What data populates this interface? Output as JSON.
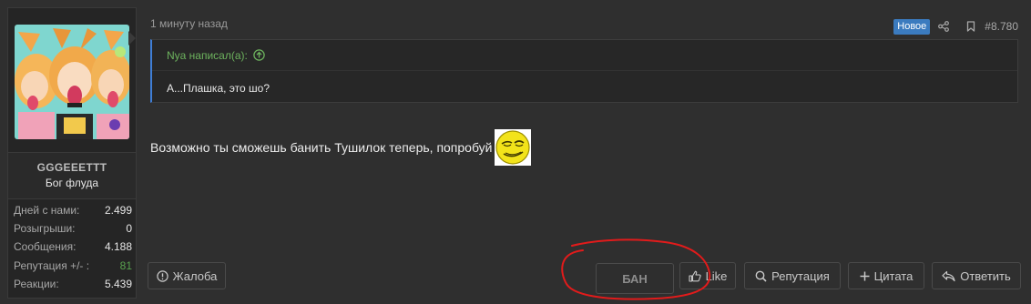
{
  "user": {
    "username": "GGGEEETTT",
    "title": "Бог флуда",
    "stats": [
      {
        "label": "Дней с нами:",
        "value": "2.499",
        "positive": false
      },
      {
        "label": "Розыгрыши:",
        "value": "0",
        "positive": false
      },
      {
        "label": "Сообщения:",
        "value": "4.188",
        "positive": false
      },
      {
        "label": "Репутация +/- :",
        "value": "81",
        "positive": true
      },
      {
        "label": "Реакции:",
        "value": "5.439",
        "positive": false
      }
    ]
  },
  "post": {
    "time": "1 минуту назад",
    "badge": "Новое",
    "number": "#8.780",
    "share_icon": "share-icon",
    "bookmark_icon": "bookmark-icon"
  },
  "quote": {
    "title": "Nya написал(а):",
    "body": "А...Плашка, это шо?"
  },
  "message": {
    "text": "Возможно ты сможешь банить Тушилок теперь, попробуй"
  },
  "actions": {
    "report": "Жалоба",
    "ban": "БАН",
    "like": "Like",
    "reputation": "Репутация",
    "quote": "Цитата",
    "reply": "Ответить"
  },
  "colors": {
    "accent_blue": "#3b7bbf",
    "quote_border": "#3f7ed6",
    "positive_green": "#59a34f",
    "annotation_red": "#e21b1b"
  }
}
